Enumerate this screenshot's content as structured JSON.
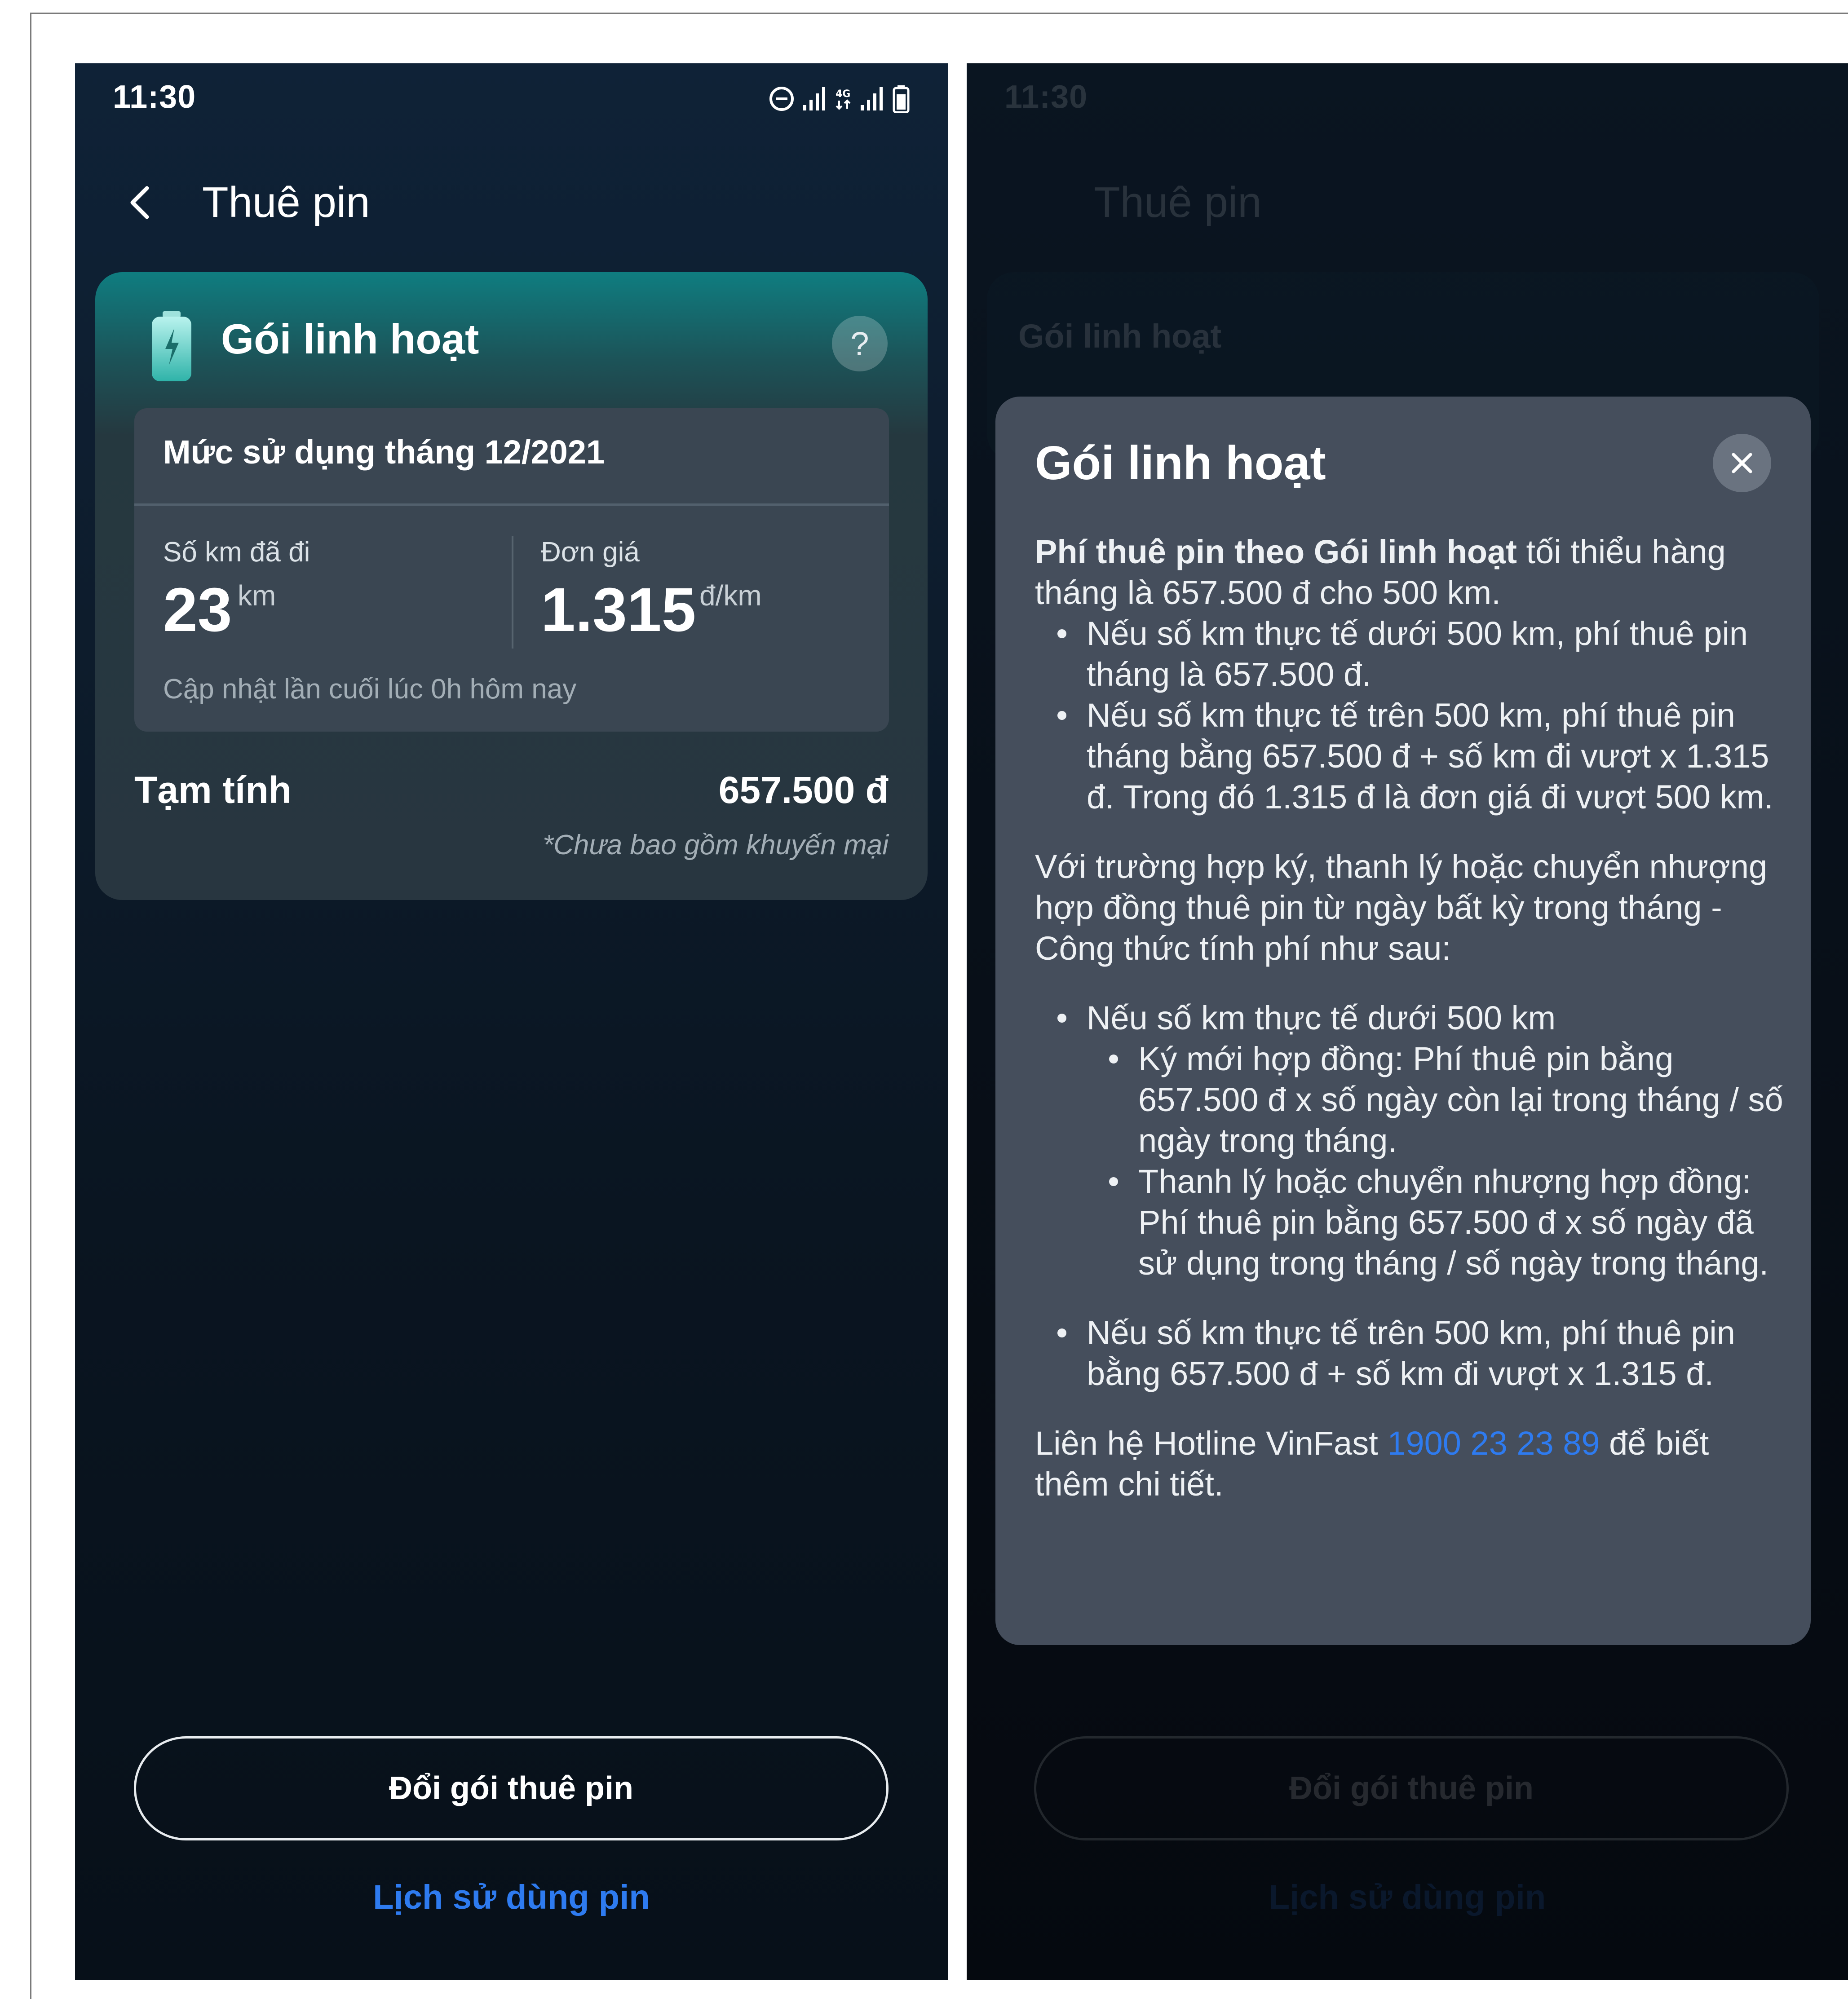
{
  "status_bar": {
    "time": "11:30"
  },
  "left": {
    "header": {
      "title": "Thuê pin"
    },
    "plan_card": {
      "title": "Gói linh hoạt",
      "help_symbol": "?",
      "usage": {
        "heading": "Mức sử dụng tháng 12/2021",
        "km_label": "Số km đã đi",
        "km_value": "23",
        "km_unit": "km",
        "price_label": "Đơn giá",
        "price_value": "1.315",
        "price_unit": "đ/km",
        "updated": "Cập nhật lần cuối lúc 0h hôm nay"
      },
      "estimate": {
        "label": "Tạm tính",
        "value": "657.500 đ",
        "note": "*Chưa bao gồm khuyến mại"
      }
    },
    "change_button": "Đổi gói thuê pin",
    "history_link": "Lịch sử dùng pin"
  },
  "right": {
    "background": {
      "title": "Thuê pin",
      "card_title": "Gói linh hoạt",
      "change_button": "Đổi gói thuê pin",
      "history_link": "Lịch sử dùng pin"
    },
    "modal": {
      "title": "Gói linh hoạt",
      "intro_bold": "Phí thuê pin theo Gói linh hoạt",
      "intro_rest": " tối thiểu hàng tháng là 657.500 đ cho 500 km.",
      "bullets_1": [
        "Nếu số km thực tế dưới 500 km, phí thuê pin tháng là 657.500 đ.",
        "Nếu số km thực tế trên 500 km, phí thuê pin tháng bằng 657.500 đ + số km đi vượt x 1.315 đ. Trong đó 1.315 đ là đơn giá đi vượt 500 km."
      ],
      "para2": "Với trường hợp ký, thanh lý hoặc chuyển nhượng hợp đồng thuê pin từ ngày bất kỳ trong tháng - Công thức tính phí như sau:",
      "bullet_under": "Nếu số km thực tế dưới 500 km",
      "sub_bullets": [
        "Ký mới hợp đồng: Phí thuê pin bằng 657.500 đ x số ngày còn lại trong tháng / số ngày trong tháng.",
        "Thanh lý hoặc chuyển nhượng hợp đồng: Phí thuê pin bằng 657.500 đ x số ngày đã sử dụng trong tháng / số ngày trong tháng."
      ],
      "bullet_over": "Nếu số km thực tế trên 500 km, phí thuê pin bằng 657.500 đ + số km đi vượt x 1.315 đ.",
      "contact_pre": "Liên hệ Hotline VinFast ",
      "hotline": "1900 23 23 89",
      "contact_post": " để biết thêm chi tiết."
    }
  },
  "colors": {
    "accent_teal": "#0f7d80",
    "link_blue": "#2e7bf0",
    "modal_bg": "#454e5c",
    "card_bg": "#3a4652"
  },
  "icons": [
    "back-arrow-icon",
    "battery-charge-icon",
    "help-icon",
    "close-icon",
    "dnd-icon",
    "signal-icon",
    "4g-icon",
    "battery-status-icon"
  ]
}
